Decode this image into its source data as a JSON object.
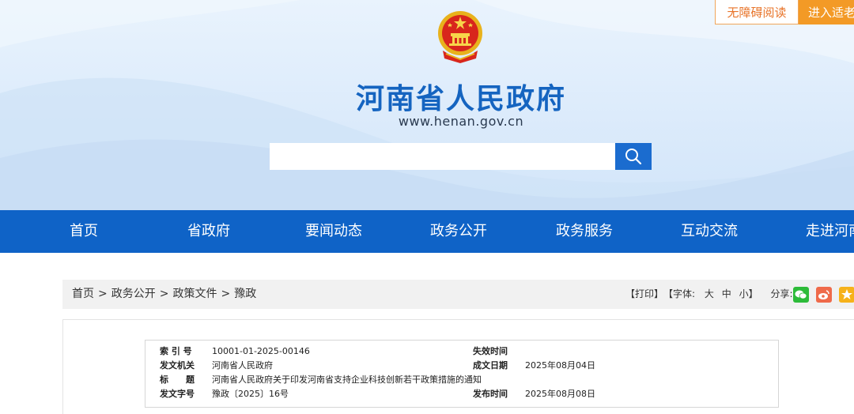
{
  "header": {
    "accessible_label": "无障碍阅读",
    "elder_label": "进入适老",
    "title": "河南省人民政府",
    "url": "www.henan.gov.cn",
    "search": {
      "placeholder": ""
    }
  },
  "nav": {
    "items": [
      "首页",
      "省政府",
      "要闻动态",
      "政务公开",
      "政务服务",
      "互动交流",
      "走进河南"
    ]
  },
  "breadcrumb": {
    "items": [
      "首页",
      "政务公开",
      "政策文件",
      "豫政"
    ],
    "separator": ">"
  },
  "tools": {
    "print": "【打印】",
    "font_label": "【字体:",
    "font_large": "大",
    "font_medium": "中",
    "font_small": "小",
    "font_close": "】",
    "share_label": "分享:"
  },
  "colors": {
    "brand_blue": "#0f63c7",
    "accent_orange": "#f39a26",
    "wechat_green": "#2dbb39",
    "weibo_orange": "#ef6a4a",
    "star_yellow": "#f6b21b"
  },
  "meta": {
    "index_label": "索 引 号",
    "index_value": "10001-01-2025-00146",
    "expire_label": "失效时间",
    "expire_value": "",
    "issuer_label": "发文机关",
    "issuer_value": "河南省人民政府",
    "created_label": "成文日期",
    "created_value": "2025年08月04日",
    "title_label": "标　　题",
    "title_value": "河南省人民政府关于印发河南省支持企业科技创新若干政策措施的通知",
    "docno_label": "发文字号",
    "docno_value": "豫政〔2025〕16号",
    "publish_label": "发布时间",
    "publish_value": "2025年08月08日"
  }
}
